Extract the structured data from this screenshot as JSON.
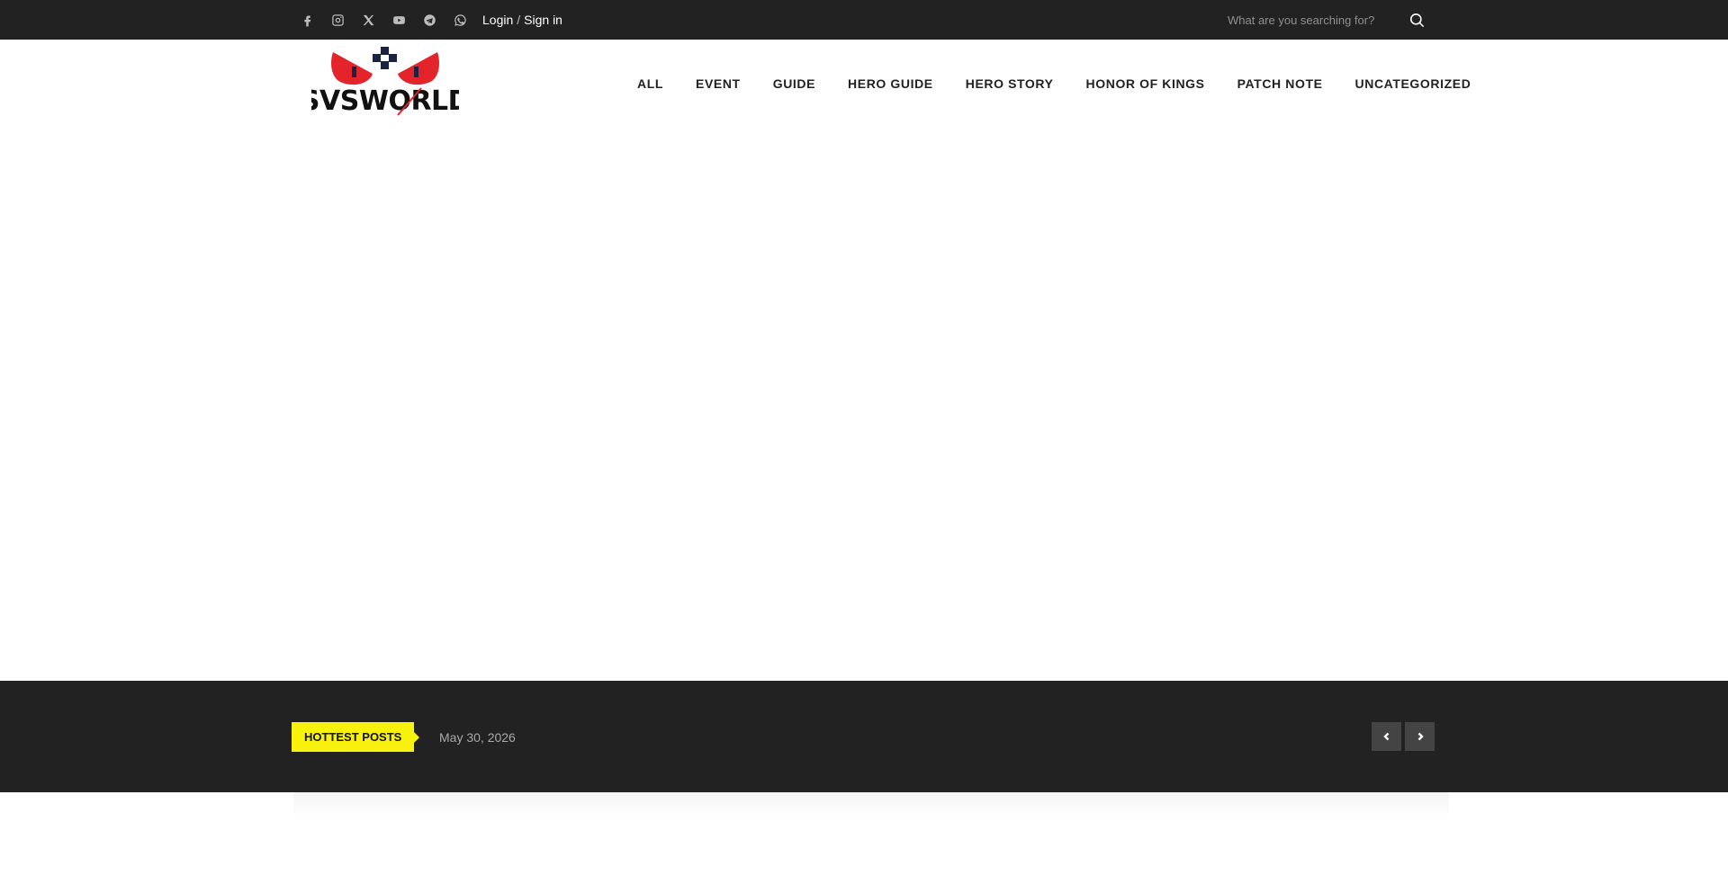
{
  "topbar": {
    "social_icons": [
      "facebook-icon",
      "instagram-icon",
      "x-twitter-icon",
      "youtube-icon",
      "telegram-icon",
      "whatsapp-icon"
    ],
    "login_label": "Login",
    "separator": "/",
    "signin_label": "Sign in",
    "search_placeholder": "What are you searching for?"
  },
  "header": {
    "logo_text": "SVSWORLD",
    "nav": [
      "ALL",
      "EVENT",
      "GUIDE",
      "HERO GUIDE",
      "HERO STORY",
      "HONOR OF KINGS",
      "PATCH NOTE",
      "UNCATEGORIZED"
    ]
  },
  "ticker": {
    "badge": "HOTTEST POSTS",
    "date": "May 30, 2026"
  },
  "colors": {
    "topbar_bg": "#222222",
    "accent_yellow": "#f7f10d",
    "logo_red": "#e3242b"
  }
}
